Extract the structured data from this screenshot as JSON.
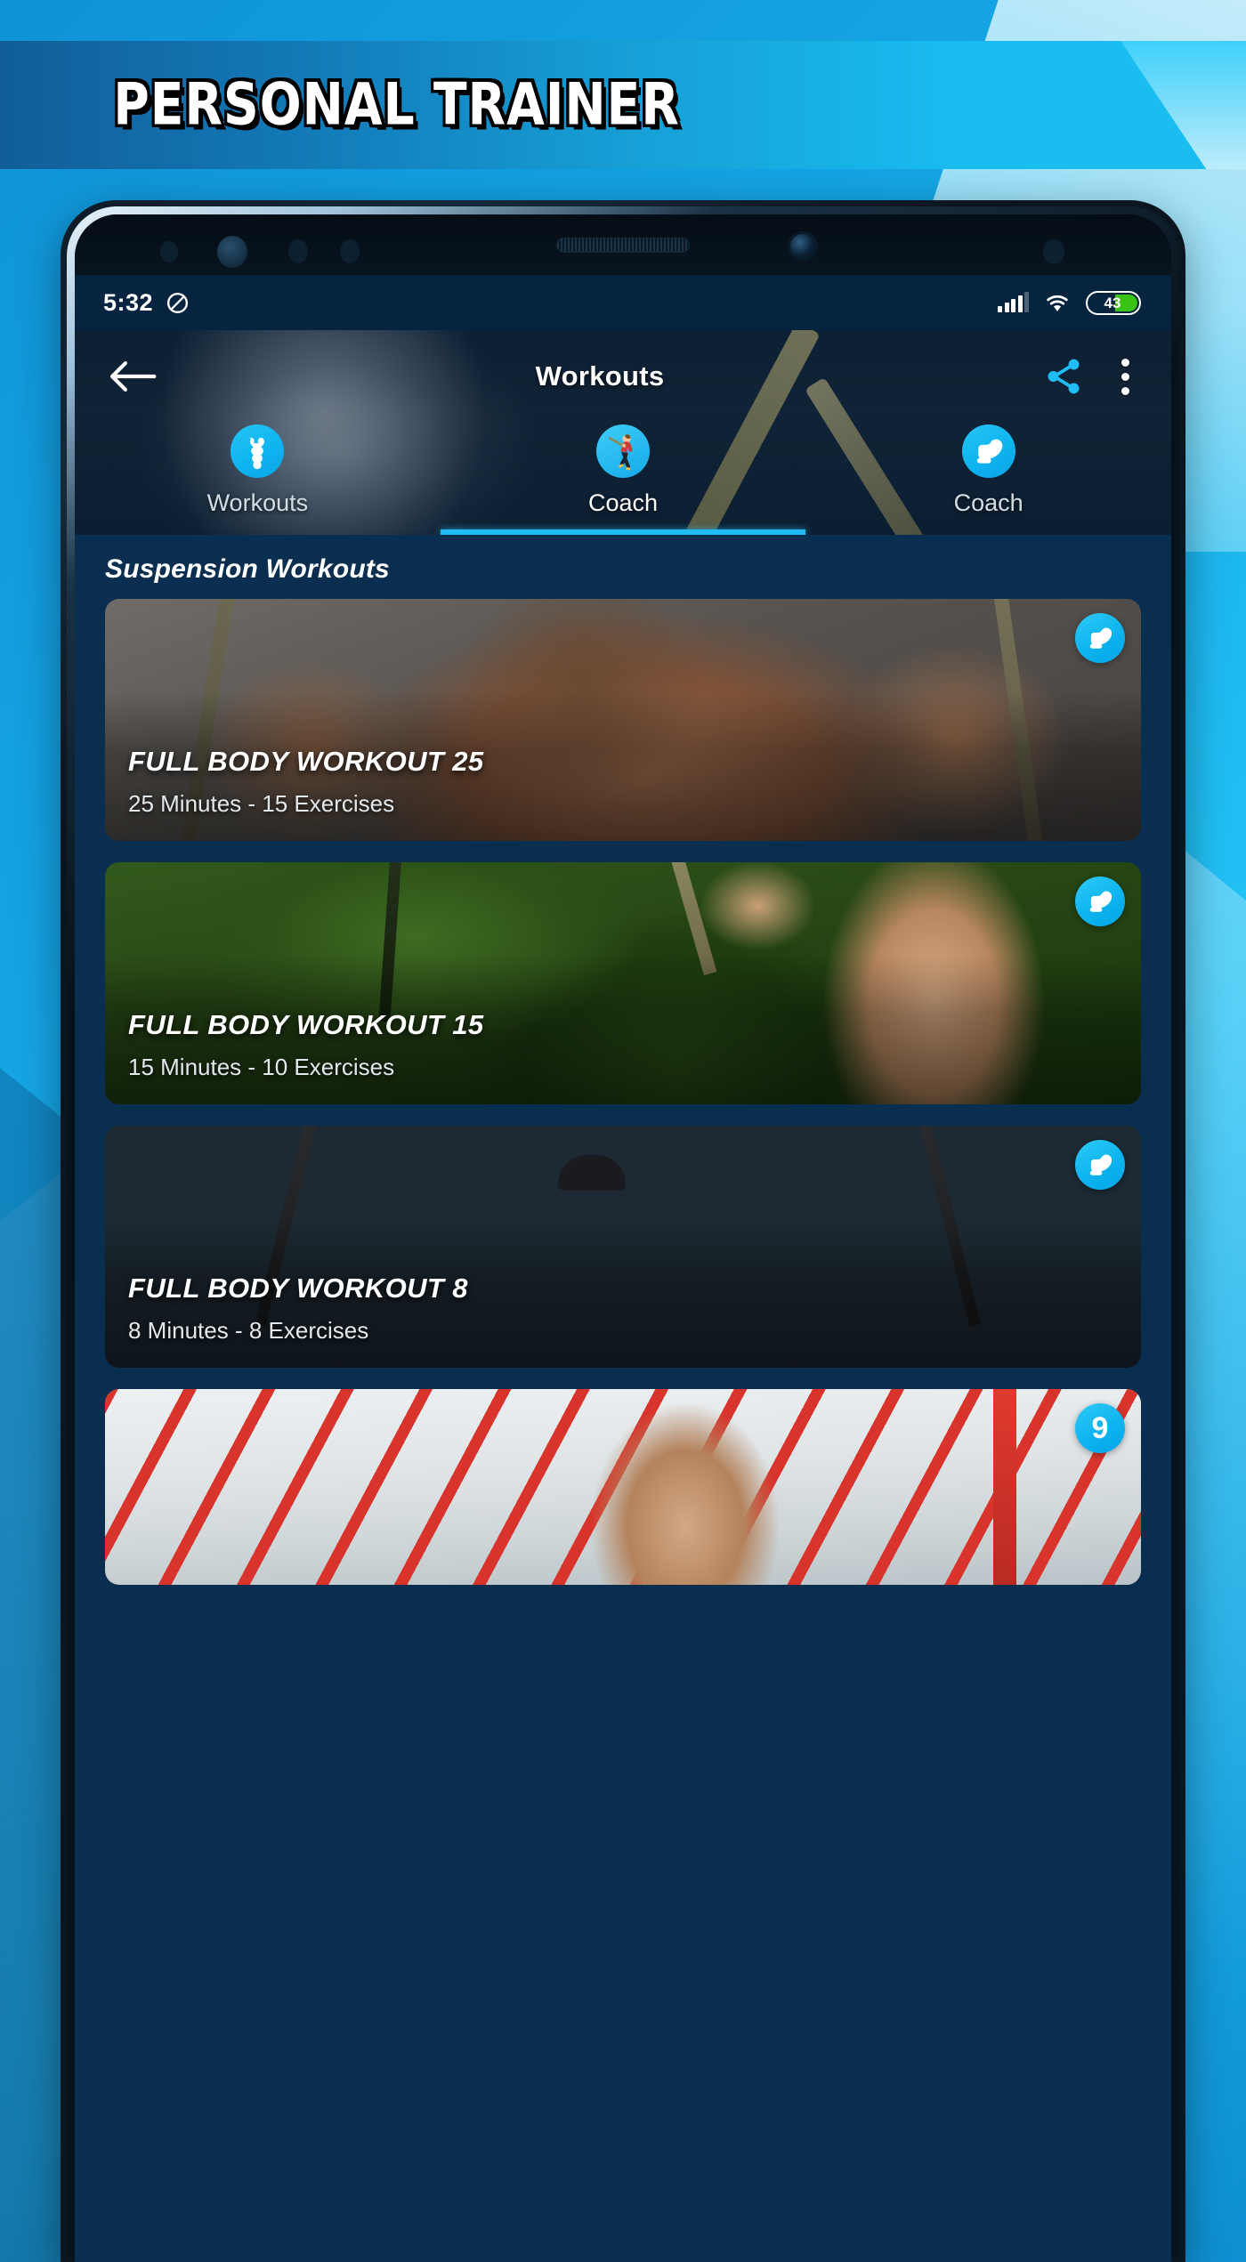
{
  "banner": {
    "title": "PERSONAL TRAINER"
  },
  "statusbar": {
    "time": "5:32",
    "dnd_icon": "do-not-disturb-icon",
    "signal_icon": "cellular-signal-icon",
    "wifi_icon": "wifi-icon",
    "battery_percent": "43",
    "battery_fill_color": "#39c413"
  },
  "toolbar": {
    "back_icon": "back-arrow-icon",
    "title": "Workouts",
    "share_icon": "share-icon",
    "overflow_icon": "overflow-menu-icon",
    "accent_color": "#1fbcf5"
  },
  "tabs": {
    "active_index": 1,
    "items": [
      {
        "label": "Workouts",
        "icon": "muscle-anatomy-icon"
      },
      {
        "label": "Coach",
        "icon": "coach-person-icon"
      },
      {
        "label": "Coach",
        "icon": "bicep-flex-icon"
      }
    ]
  },
  "section": {
    "title": "Suspension Workouts"
  },
  "workouts": [
    {
      "title": "FULL BODY WORKOUT 25",
      "subtitle": "25 Minutes - 15 Exercises",
      "minutes": "25",
      "exercises": "15",
      "badge_icon": "bicep-flex-icon",
      "badge_text": ""
    },
    {
      "title": "FULL BODY WORKOUT 15",
      "subtitle": "15 Minutes - 10 Exercises",
      "minutes": "15",
      "exercises": "10",
      "badge_icon": "bicep-flex-icon",
      "badge_text": ""
    },
    {
      "title": "FULL BODY WORKOUT 8",
      "subtitle": "8 Minutes - 8 Exercises",
      "minutes": "8",
      "exercises": "8",
      "badge_icon": "bicep-flex-icon",
      "badge_text": ""
    },
    {
      "title": "",
      "subtitle": "",
      "minutes": "",
      "exercises": "",
      "badge_icon": "number-badge",
      "badge_text": "9"
    }
  ],
  "colors": {
    "app_background": "#0a2e4f",
    "status_background": "#06243f",
    "accent_cyan": "#1fbcf5",
    "page_background": "#16a9e8"
  }
}
